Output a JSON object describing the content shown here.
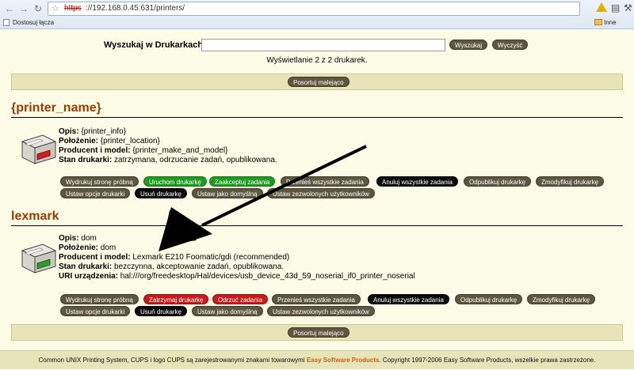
{
  "browser": {
    "url_scheme": "https",
    "url_rest": "://192.168.0.45:631/printers/",
    "bookmark_left": "Dostosuj łącza",
    "bookmark_right": "Inne zakład"
  },
  "search": {
    "label": "Wyszukaj w Drukarkach:",
    "value": "",
    "search_btn": "Wyszukaj",
    "clear_btn": "Wyczyść"
  },
  "count_text": "Wyświetlanie 2 z 2 drukarek.",
  "sort_btn": "Posortuj malejąco",
  "printers": [
    {
      "name": "{printer_name}",
      "info": [
        {
          "label": "Opis:",
          "value": "{printer_info}"
        },
        {
          "label": "Położenie:",
          "value": "{printer_location}"
        },
        {
          "label": "Producent i model:",
          "value": "{printer_make_and_model}"
        },
        {
          "label": "Stan drukarki:",
          "value": "zatrzymana, odrzucanie zadań, opublikowana."
        }
      ],
      "buttons_row1": [
        "Wydrukuj stronę próbną",
        "Uruchom drukarkę",
        "Zaakceptuj zadania",
        "Przenieś wszystkie zadania",
        "Anuluj wszystkie zadania",
        "Odpublikuj drukarkę",
        "Zmodyfikuj drukarkę"
      ],
      "buttons_row2": [
        "Ustaw opcje drukarki",
        "Usuń drukarkę",
        "Ustaw jako domyślną",
        "Ustaw zezwolonych użytkowników"
      ]
    },
    {
      "name": "lexmark",
      "info": [
        {
          "label": "Opis:",
          "value": "dom"
        },
        {
          "label": "Położenie:",
          "value": "dom"
        },
        {
          "label": "Producent i model:",
          "value": "Lexmark E210 Foomatic/gdi (recommended)"
        },
        {
          "label": "Stan drukarki:",
          "value": "bezczynna, akceptowanie zadań, opublikowana."
        },
        {
          "label": "URI urządzenia:",
          "value": "hal:///org/freedesktop/Hal/devices/usb_device_43d_59_noserial_if0_printer_noserial"
        }
      ],
      "buttons_row1": [
        "Wydrukuj stronę próbną",
        "Zatrzymaj drukarkę",
        "Odrzuć zadania",
        "Przenieś wszystkie zadania",
        "Anuluj wszystkie zadania",
        "Odpublikuj drukarkę",
        "Zmodyfikuj drukarkę"
      ],
      "buttons_row2": [
        "Ustaw opcje drukarki",
        "Usuń drukarkę",
        "Ustaw jako domyślną",
        "Ustaw zezwolonych użytkowników"
      ]
    }
  ],
  "footer": {
    "prefix": "Common UNIX Printing System, CUPS i logo CUPS są zarejestrowanymi znakami towarowymi ",
    "company": "Easy Software Products",
    "suffix": ". Copyright 1997-2006 Easy Software Products, wszelkie prawa zastrzeżone."
  },
  "colors": {
    "page_bg": "#fbfbe6",
    "accent_title": "#993d00",
    "button_default": "#5d5740",
    "button_green": "#1e9a22",
    "button_red": "#c81b1b",
    "button_black": "#0a0a0a"
  }
}
